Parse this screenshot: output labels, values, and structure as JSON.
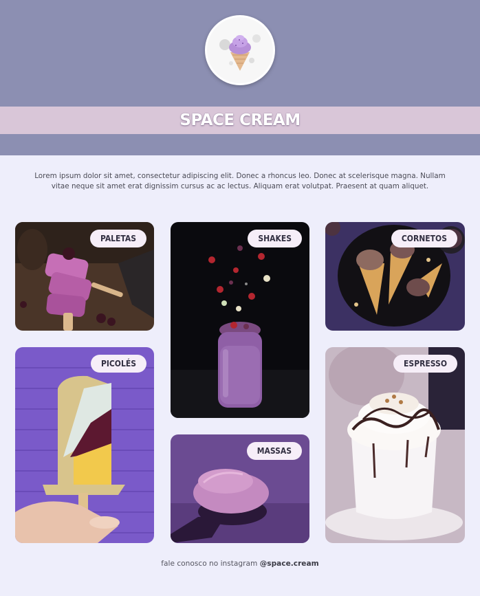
{
  "brand": {
    "name": "SPACE CREAM",
    "logo_icon": "ice-cream-cone-icon"
  },
  "intro": "Lorem ipsum dolor sit amet, consectetur adipiscing elit. Donec a rhoncus leo. Donec at scelerisque magna. Nullam vitae neque sit amet erat dignissim cursus ac ac lectus. Aliquam erat volutpat. Praesent at quam aliquet.",
  "categories": {
    "paletas": "PALETAS",
    "shakes": "SHAKES",
    "cornetos": "CORNETOS",
    "picoles": "PICOLÉS",
    "massas": "MASSAS",
    "espresso": "ESPRESSO"
  },
  "footer": {
    "text": "fale conosco no instagram ",
    "handle": "@space.cream"
  },
  "colors": {
    "header": "#8c8fb2",
    "banner": "#d9c6d8",
    "page_background": "#eeeefb",
    "tag_background": "#f6eef8"
  }
}
